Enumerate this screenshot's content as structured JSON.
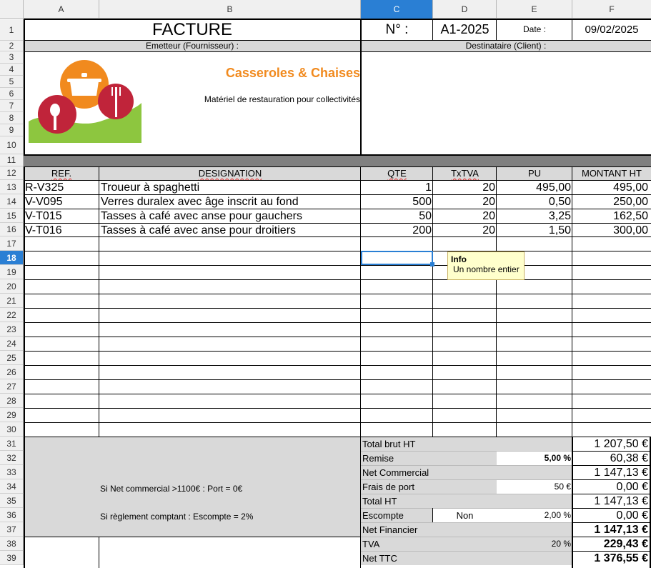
{
  "columns": [
    "A",
    "B",
    "C",
    "D",
    "E",
    "F"
  ],
  "active_column": "C",
  "row_numbers": [
    "1",
    "2",
    "3",
    "4",
    "5",
    "6",
    "7",
    "8",
    "9",
    "10",
    "11",
    "12",
    "13",
    "14",
    "15",
    "16",
    "17",
    "18",
    "19",
    "20",
    "21",
    "22",
    "23",
    "24",
    "25",
    "26",
    "27",
    "28",
    "29",
    "30",
    "31",
    "32",
    "33",
    "34",
    "35",
    "36",
    "37",
    "38",
    "39"
  ],
  "active_row": "18",
  "invoice": {
    "title": "FACTURE",
    "number_label": "N° :",
    "number": "A1-2025",
    "date_label": "Date :",
    "date": "09/02/2025",
    "issuer_label": "Emetteur (Fournisseur) :",
    "client_label": "Destinataire (Client) :",
    "company_name": "Casseroles & Chaises",
    "company_tagline": "Matériel de restauration pour collectivités",
    "colors": {
      "orange": "#f18a1e",
      "red": "#c0243a",
      "green": "#8dc63f",
      "header_gray": "#d9d9d9",
      "band_gray": "#808080",
      "select_blue": "#2a7fd4"
    }
  },
  "table": {
    "headers": [
      "REF.",
      "DESIGNATION",
      "QTE",
      "TxTVA",
      "PU",
      "MONTANT HT"
    ],
    "rows": [
      {
        "ref": "R-V325",
        "designation": "Troueur à spaghetti",
        "qte": "1",
        "tva": "20",
        "pu": "495,00",
        "montant": "495,00"
      },
      {
        "ref": "V-V095",
        "designation": "Verres duralex avec âge inscrit au fond",
        "qte": "500",
        "tva": "20",
        "pu": "0,50",
        "montant": "250,00"
      },
      {
        "ref": "V-T015",
        "designation": "Tasses à café avec anse pour gauchers",
        "qte": "50",
        "tva": "20",
        "pu": "3,25",
        "montant": "162,50"
      },
      {
        "ref": "V-T016",
        "designation": "Tasses à café avec anse pour droitiers",
        "qte": "200",
        "tva": "20",
        "pu": "1,50",
        "montant": "300,00"
      }
    ]
  },
  "tooltip": {
    "title": "Info",
    "text": "Un nombre entier"
  },
  "notes": {
    "port": "Si Net commercial >1100€ : Port = 0€",
    "escompte": "Si règlement comptant : Escompte = 2%"
  },
  "totals": {
    "brut_label": "Total brut HT",
    "brut_value": "1 207,50 €",
    "remise_label": "Remise",
    "remise_rate": "5,00 %",
    "remise_value": "60,38 €",
    "net_com_label": "Net Commercial",
    "net_com_value": "1 147,13 €",
    "port_label": "Frais de port",
    "port_rate": "50 €",
    "port_value": "0,00 €",
    "total_ht_label": "Total HT",
    "total_ht_value": "1 147,13 €",
    "escompte_label": "Escompte",
    "escompte_choice": "Non",
    "escompte_rate": "2,00 %",
    "escompte_value": "0,00 €",
    "net_fin_label": "Net Financier",
    "net_fin_value": "1 147,13 €",
    "tva_label": "TVA",
    "tva_rate": "20 %",
    "tva_value": "229,43 €",
    "ttc_label": "Net TTC",
    "ttc_value": "1 376,55 €"
  }
}
